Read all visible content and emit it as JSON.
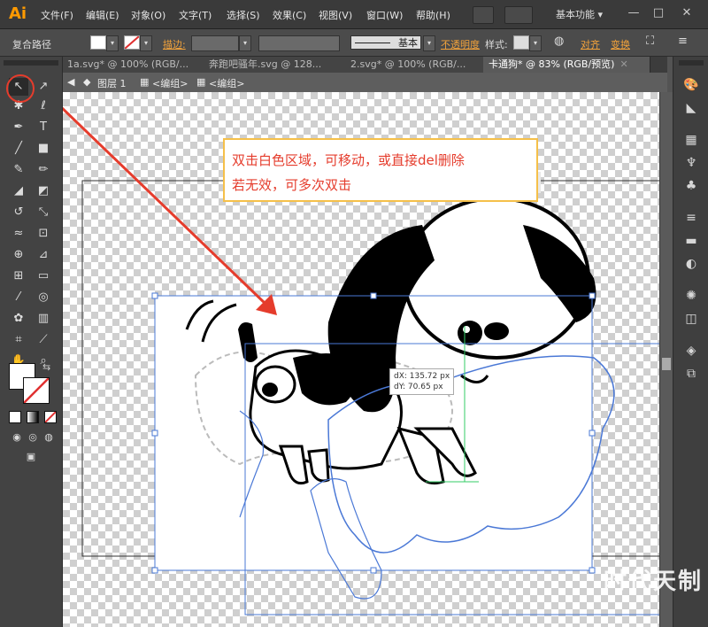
{
  "app": {
    "logo": "Ai",
    "workspace": "基本功能",
    "workspace_arrow": "▾"
  },
  "menu": [
    "文件(F)",
    "编辑(E)",
    "对象(O)",
    "文字(T)",
    "选择(S)",
    "效果(C)",
    "视图(V)",
    "窗口(W)",
    "帮助(H)"
  ],
  "window_controls": {
    "minimize": "—",
    "restore": "□",
    "close": "✕"
  },
  "control_bar": {
    "object_type": "复合路径",
    "stroke_label": "描边:",
    "stroke_profile": "基本",
    "opacity_label": "不透明度",
    "style_label": "样式:",
    "align_label": "对齐",
    "transform_label": "变换"
  },
  "tabs": [
    {
      "label": "1a.svg* @ 100% (RGB/...",
      "active": false
    },
    {
      "label": "奔跑吧骚年.svg @ 128...",
      "active": false
    },
    {
      "label": "2.svg* @ 100% (RGB/...",
      "active": false
    },
    {
      "label": "卡通狗* @ 83% (RGB/预览)",
      "active": true
    }
  ],
  "breadcrumb": {
    "layer": "图层 1",
    "group1": "<编组>",
    "group2": "<编组>"
  },
  "callout": {
    "line1": "双击白色区域，可移动，或直接del删除",
    "line2": "若无效，可多次双击"
  },
  "measure": {
    "dx": "dX: 135.72 px",
    "dy": "dY: 70.65 px"
  },
  "watermark": "时代天制",
  "colors": {
    "accent_orange": "#f3a33b",
    "annotation_red": "#e53c2c",
    "callout_border": "#f5c04a",
    "selection_blue": "#4a78d6",
    "guide_green": "#33cc66"
  },
  "icons": {
    "toolbar": [
      "selection-icon",
      "direct-selection-icon",
      "magic-wand-icon",
      "lasso-icon",
      "pen-icon",
      "type-icon",
      "line-icon",
      "rectangle-icon",
      "paintbrush-icon",
      "pencil-icon",
      "blob-brush-icon",
      "eraser-icon",
      "rotate-icon",
      "scale-icon",
      "width-icon",
      "free-transform-icon",
      "shape-builder-icon",
      "perspective-grid-icon",
      "mesh-icon",
      "gradient-icon",
      "eyedropper-icon",
      "blend-icon",
      "symbol-sprayer-icon",
      "column-graph-icon",
      "artboard-icon",
      "slice-icon",
      "hand-icon",
      "zoom-icon"
    ],
    "dock": [
      "color-icon",
      "color-guide-icon",
      "swatches-icon",
      "brushes-icon",
      "symbols-icon",
      "stroke-icon",
      "gradient-panel-icon",
      "transparency-icon",
      "appearance-icon",
      "graphic-styles-icon",
      "layers-icon",
      "artboards-panel-icon"
    ]
  }
}
